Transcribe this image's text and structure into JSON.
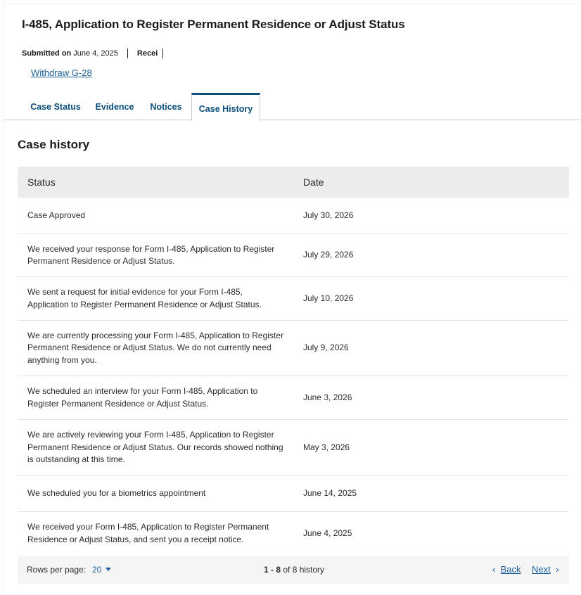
{
  "header": {
    "title": "I-485, Application to Register Permanent Residence or Adjust Status",
    "submitted_label": "Submitted on",
    "submitted_date": "June 4, 2025",
    "receipt_label": "Recei",
    "withdraw_link": "Withdraw G-28"
  },
  "tabs": [
    {
      "label": "Case Status"
    },
    {
      "label": "Evidence"
    },
    {
      "label": "Notices"
    },
    {
      "label": "Case History",
      "active": true
    }
  ],
  "case_history": {
    "title": "Case history",
    "columns": {
      "status": "Status",
      "date": "Date"
    },
    "rows": [
      {
        "status": "Case Approved",
        "date": "July 30, 2026"
      },
      {
        "status": "We received your response for Form I-485, Application to Register Permanent Residence or Adjust Status.",
        "date": "July 29, 2026"
      },
      {
        "status": "We sent a request for initial evidence for your Form I-485, Application to Register Permanent Residence or Adjust Status.",
        "date": "July 10, 2026"
      },
      {
        "status": "We are currently processing your Form I-485, Application to Register Permanent Residence or Adjust Status.  We do not currently need anything from you.",
        "date": "July 9, 2026"
      },
      {
        "status": "We scheduled an interview for your Form I-485, Application to Register Permanent Residence or Adjust Status.",
        "date": "June 3, 2026"
      },
      {
        "status": "We are actively reviewing your Form I-485, Application to Register Permanent Residence or Adjust Status. Our records showed nothing is outstanding at this time.",
        "date": "May 3, 2026"
      },
      {
        "status": "We scheduled you for a biometrics appointment",
        "date": "June 14, 2025"
      },
      {
        "status": "We received your Form I-485, Application to Register Permanent Residence or Adjust Status, and sent you a receipt notice.",
        "date": "June 4, 2025"
      }
    ]
  },
  "pagination": {
    "rows_per_page_label": "Rows per page:",
    "rows_per_page_value": "20",
    "range": "1 - 8",
    "range_suffix": "of 8 history",
    "back_label": "Back",
    "next_label": "Next"
  },
  "colors": {
    "link": "#1a5e9a",
    "tab_accent": "#0b4f7c",
    "header_bg": "#ececec"
  }
}
